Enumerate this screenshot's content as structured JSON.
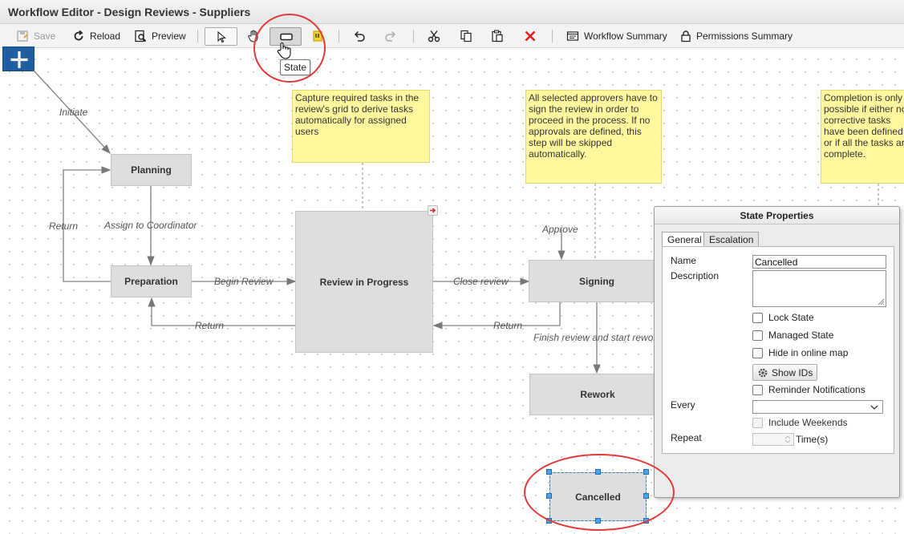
{
  "window": {
    "title": "Workflow Editor - Design Reviews - Suppliers"
  },
  "toolbar": {
    "save_label": "Save",
    "reload_label": "Reload",
    "preview_label": "Preview",
    "workflow_summary_label": "Workflow Summary",
    "permissions_summary_label": "Permissions Summary"
  },
  "tooltip": {
    "text": "State"
  },
  "nodes": {
    "planning": "Planning",
    "preparation": "Preparation",
    "review_in_progress": "Review in Progress",
    "signing": "Signing",
    "rework": "Rework",
    "cancelled": "Cancelled"
  },
  "edges": {
    "initiate": "Initiate",
    "return_planning": "Return",
    "assign_to_coordinator": "Assign to Coordinator",
    "begin_review": "Begin Review",
    "return_preparation": "Return",
    "close_review": "Close review",
    "return_review": "Return",
    "approve": "Approve",
    "finish_review": "Finish review and start rework"
  },
  "notes": {
    "note1": "Capture required tasks in the review's grid to derive tasks automatically for assigned users",
    "note2": "All selected approvers have to sign the review in order to proceed in the process. If no approvals are defined, this step will be skipped automatically.",
    "note3": "Completion is only possible if either no corrective tasks have been defined or if all the tasks are complete."
  },
  "state_properties": {
    "title": "State Properties",
    "tabs": [
      "General",
      "Escalation"
    ],
    "name_label": "Name",
    "name_value": "Cancelled",
    "description_label": "Description",
    "lock_state": "Lock State",
    "managed_state": "Managed State",
    "hide_in_online_map": "Hide in online map",
    "show_ids": "Show IDs",
    "reminder_notifications": "Reminder Notifications",
    "every_label": "Every",
    "include_weekends": "Include Weekends",
    "repeat_label": "Repeat",
    "times_label": "Time(s)"
  },
  "colors": {
    "note_fill": "#fff89f",
    "node_fill": "#dedede",
    "highlight_red": "#e2383a",
    "selection_blue": "#4aa3ea",
    "add_button": "#1f5fa0"
  }
}
